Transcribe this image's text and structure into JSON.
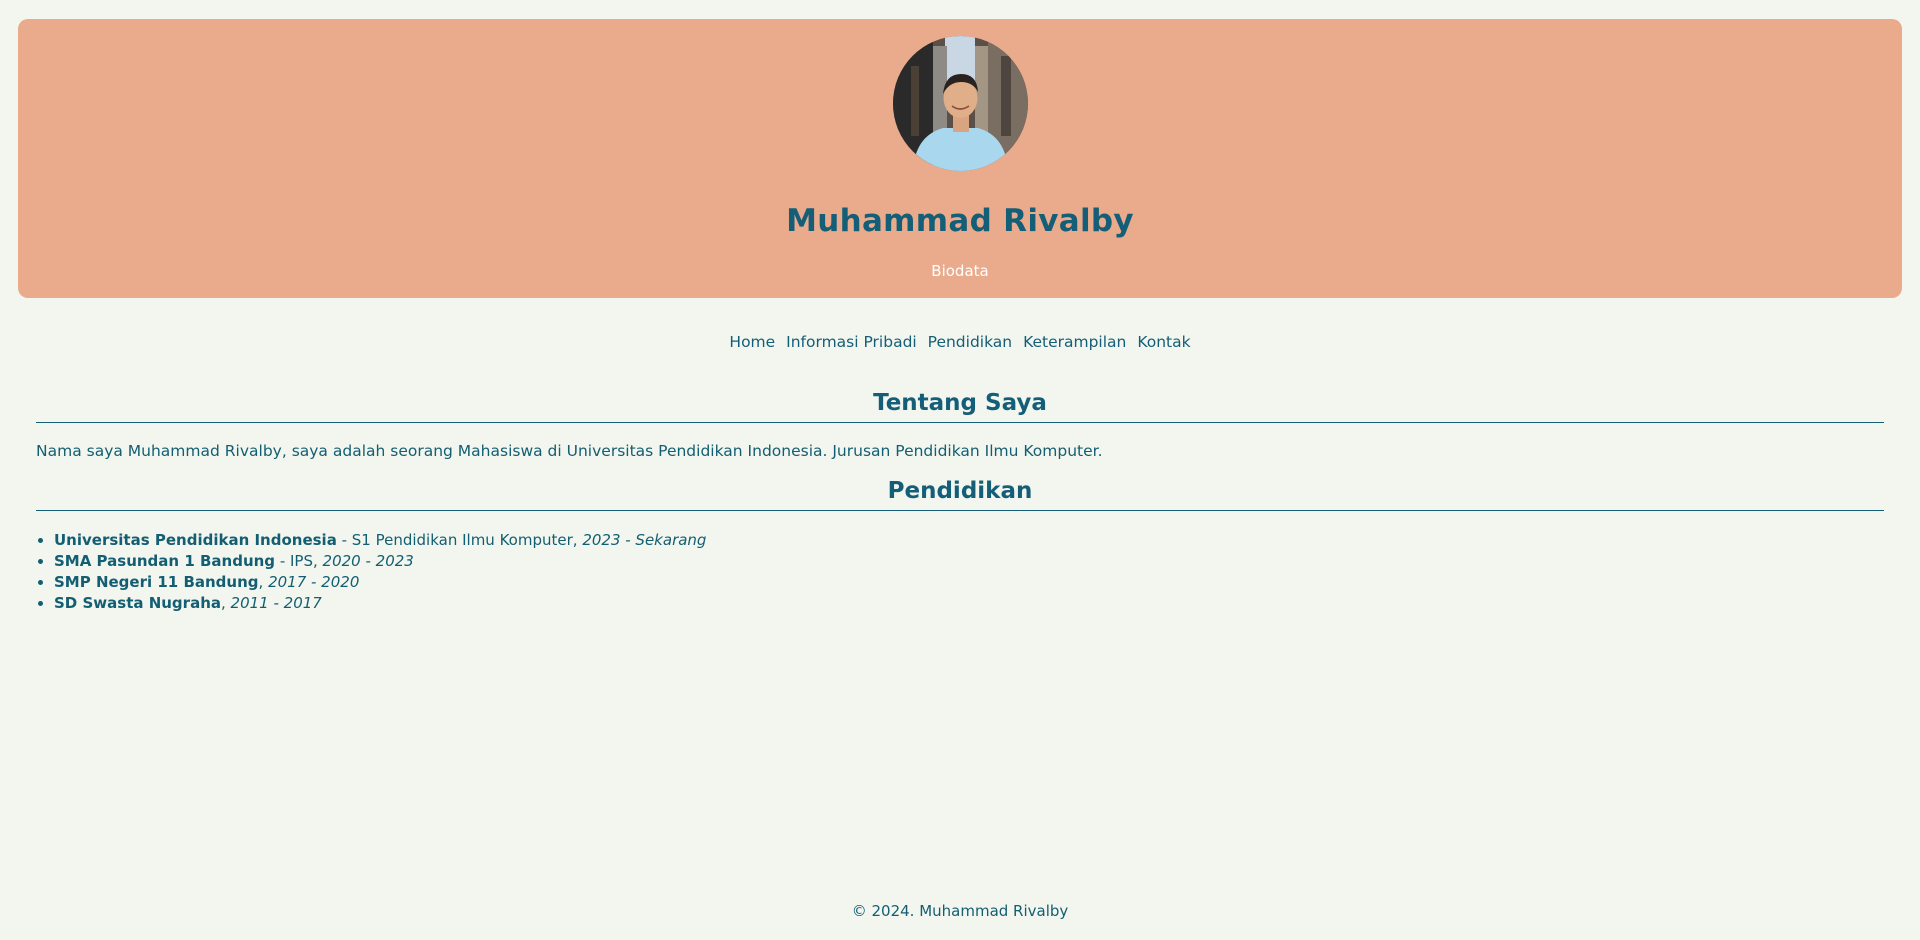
{
  "header": {
    "name": "Muhammad Rivalby",
    "subtitle": "Biodata",
    "avatar_icon": "profile-photo"
  },
  "nav": {
    "items": [
      "Home",
      "Informasi Pribadi",
      "Pendidikan",
      "Keterampilan",
      "Kontak"
    ]
  },
  "about": {
    "title": "Tentang Saya",
    "text": "Nama saya Muhammad Rivalby, saya adalah seorang Mahasiswa di Universitas Pendidikan Indonesia. Jurusan Pendidikan Ilmu Komputer."
  },
  "education": {
    "title": "Pendidikan",
    "items": [
      {
        "school": "Universitas Pendidikan Indonesia",
        "detail": " - S1 Pendidikan Ilmu Komputer, ",
        "years": "2023 - Sekarang"
      },
      {
        "school": "SMA Pasundan 1 Bandung",
        "detail": " - IPS, ",
        "years": "2020 - 2023"
      },
      {
        "school": "SMP Negeri 11 Bandung",
        "detail": ", ",
        "years": "2017 - 2020"
      },
      {
        "school": "SD Swasta Nugraha",
        "detail": ", ",
        "years": "2011 - 2017"
      }
    ]
  },
  "footer": {
    "text": "© 2024. Muhammad Rivalby"
  },
  "colors": {
    "background": "#f2f6ee",
    "header_bg": "#eaab8c",
    "primary_text": "#155e78"
  }
}
